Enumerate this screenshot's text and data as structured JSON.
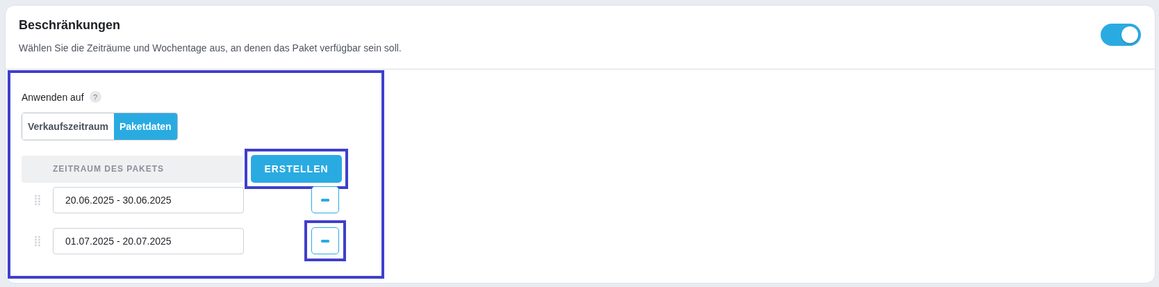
{
  "card": {
    "title": "Beschränkungen",
    "description": "Wählen Sie die Zeiträume und Wochentage aus, an denen das Paket verfügbar sein soll.",
    "toggle": {
      "on": true
    }
  },
  "section": {
    "highlighted": true,
    "label": "Anwenden auf",
    "help": "?",
    "options": [
      {
        "label": "Verkaufszeitraum",
        "selected": false
      },
      {
        "label": "Paketdaten",
        "selected": true
      }
    ],
    "table": {
      "column_header": "ZEITRAUM DES PAKETS",
      "create_button": {
        "label": "ERSTELLEN",
        "highlighted": true
      },
      "rows": [
        {
          "value": "20.06.2025 - 30.06.2025",
          "remove_highlighted": false
        },
        {
          "value": "01.07.2025 - 20.07.2025",
          "remove_highlighted": true
        }
      ]
    }
  }
}
